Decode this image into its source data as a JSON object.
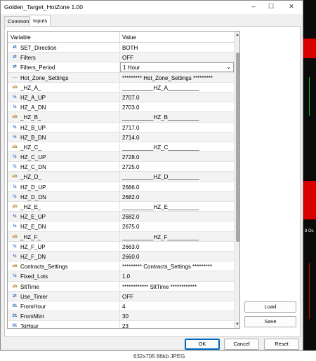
{
  "window": {
    "title": "Golden_Target_HotZone 1.00",
    "minimize": "–",
    "maximize": "☐",
    "close": "✕"
  },
  "tabs": [
    {
      "label": "Common"
    },
    {
      "label": "Inputs"
    }
  ],
  "grid": {
    "header": {
      "variable": "Variable",
      "value": "Value"
    },
    "rows": [
      {
        "icon": "arrows-icon",
        "glyph": "⇄",
        "name": "SET_Direction",
        "value": "BOTH"
      },
      {
        "icon": "arrows-icon",
        "glyph": "⇄",
        "name": "Filters",
        "value": "OFF"
      },
      {
        "icon": "arrows-icon",
        "glyph": "⇄",
        "name": "Filters_Period",
        "value": "1 Hour"
      },
      {
        "icon": "line-icon",
        "glyph": "—",
        "name": "Hot_Zone_Settings",
        "value": "********* Hot_Zone_Settings *********"
      },
      {
        "icon": "ab-icon",
        "glyph": "ab",
        "name": "_HZ_A_",
        "value": "__________HZ_A__________"
      },
      {
        "icon": "half-icon",
        "glyph": "½",
        "name": "HZ_A_UP",
        "value": "2707.0"
      },
      {
        "icon": "half-icon",
        "glyph": "½",
        "name": "HZ_A_DN",
        "value": "2703.0"
      },
      {
        "icon": "ab-icon",
        "glyph": "ab",
        "name": "_HZ_B_",
        "value": "__________HZ_B__________"
      },
      {
        "icon": "half-icon",
        "glyph": "½",
        "name": "HZ_B_UP",
        "value": "2717.0"
      },
      {
        "icon": "half-icon",
        "glyph": "½",
        "name": "HZ_B_DN",
        "value": "2714.0"
      },
      {
        "icon": "ab-icon",
        "glyph": "ab",
        "name": "_HZ_C_",
        "value": "__________HZ_C__________"
      },
      {
        "icon": "half-icon",
        "glyph": "½",
        "name": "HZ_C_UP",
        "value": "2728.0"
      },
      {
        "icon": "half-icon",
        "glyph": "½",
        "name": "HZ_C_DN",
        "value": "2725.0"
      },
      {
        "icon": "ab-icon",
        "glyph": "ab",
        "name": "_HZ_D_",
        "value": "__________HZ_D__________"
      },
      {
        "icon": "half-icon",
        "glyph": "½",
        "name": "HZ_D_UP",
        "value": "2686.0"
      },
      {
        "icon": "half-icon",
        "glyph": "½",
        "name": "HZ_D_DN",
        "value": "2682.0"
      },
      {
        "icon": "ab-icon",
        "glyph": "ab",
        "name": "_HZ_E_",
        "value": "__________HZ_E__________"
      },
      {
        "icon": "half-icon",
        "glyph": "½",
        "name": "HZ_E_UP",
        "value": "2682.0"
      },
      {
        "icon": "half-icon",
        "glyph": "½",
        "name": "HZ_E_DN",
        "value": "2675.0"
      },
      {
        "icon": "ab-icon",
        "glyph": "ab",
        "name": "_HZ_F_",
        "value": "__________HZ_F__________"
      },
      {
        "icon": "half-icon",
        "glyph": "½",
        "name": "HZ_F_UP",
        "value": "2663.0"
      },
      {
        "icon": "half-icon",
        "glyph": "½",
        "name": "HZ_F_DN",
        "value": "2660.0"
      },
      {
        "icon": "ab-icon",
        "glyph": "ab",
        "name": "Contracts_Settings",
        "value": "********* Contracts_Settings *********"
      },
      {
        "icon": "half-icon",
        "glyph": "½",
        "name": "Fixed_Lots",
        "value": "1.0"
      },
      {
        "icon": "ab-icon",
        "glyph": "ab",
        "name": "SltTime",
        "value": "************ SltTime ************"
      },
      {
        "icon": "arrows-icon",
        "glyph": "⇄",
        "name": "Use_Timer",
        "value": "OFF"
      },
      {
        "icon": "01-icon",
        "glyph": "01",
        "name": "FromHour",
        "value": "4"
      },
      {
        "icon": "01-icon",
        "glyph": "01",
        "name": "FromMint",
        "value": "30"
      },
      {
        "icon": "01-icon",
        "glyph": "01",
        "name": "ToHour",
        "value": "23"
      }
    ]
  },
  "buttons": {
    "load": "Load",
    "save": "Save",
    "ok": "OK",
    "cancel": "Cancel",
    "reset": "Reset"
  },
  "side": {
    "chart_text": "8 Oc"
  },
  "caption": "632x705  86kb  JPEG",
  "colors": {
    "accent": "#0067c0",
    "chart_red": "#d90000",
    "chart_green": "#12c312"
  }
}
